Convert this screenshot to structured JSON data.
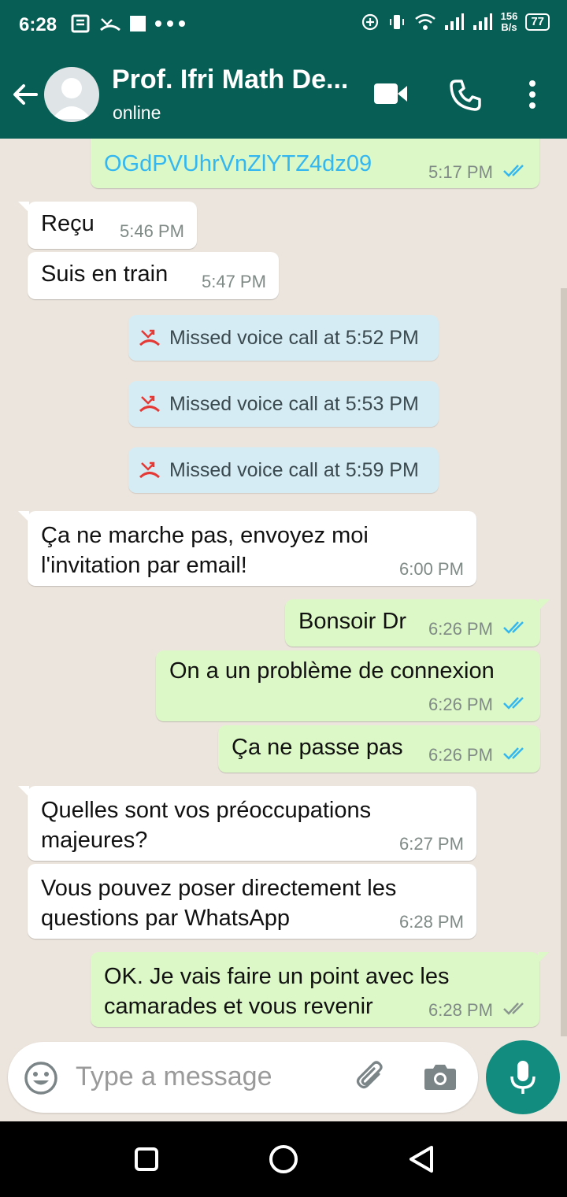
{
  "status_bar": {
    "time": "6:28",
    "net_speed_value": "156",
    "net_speed_unit": "B/s",
    "battery": "77"
  },
  "header": {
    "contact_name": "Prof. Ifri Math De...",
    "status": "online"
  },
  "messages": {
    "m0": {
      "text": "OGdPVUhrVnZlYTZ4dz09",
      "time": "5:17 PM",
      "direction": "outgoing",
      "read": true
    },
    "m1": {
      "text": "Reçu",
      "time": "5:46 PM",
      "direction": "incoming"
    },
    "m2": {
      "text": "Suis en train",
      "time": "5:47 PM",
      "direction": "incoming"
    },
    "s1": {
      "text": "Missed voice call at 5:52 PM"
    },
    "s2": {
      "text": "Missed voice call at 5:53 PM"
    },
    "s3": {
      "text": "Missed voice call at 5:59 PM"
    },
    "m3": {
      "text": "Ça ne marche pas, envoyez moi\nl'invitation par email!",
      "time": "6:00 PM",
      "direction": "incoming"
    },
    "m4": {
      "text": "Bonsoir Dr",
      "time": "6:26 PM",
      "direction": "outgoing",
      "read": true
    },
    "m5": {
      "text": "On a un problème de connexion",
      "time": "6:26 PM",
      "direction": "outgoing",
      "read": true
    },
    "m6": {
      "text": "Ça ne passe pas",
      "time": "6:26 PM",
      "direction": "outgoing",
      "read": true
    },
    "m7": {
      "text": "Quelles sont vos préoccupations\nmajeures?",
      "time": "6:27 PM",
      "direction": "incoming"
    },
    "m8": {
      "text": "Vous pouvez poser directement les\nquestions par WhatsApp",
      "time": "6:28 PM",
      "direction": "incoming"
    },
    "m9": {
      "text": "OK. Je vais faire un point avec les\ncamarades et vous revenir",
      "time": "6:28 PM",
      "direction": "outgoing",
      "read": false
    }
  },
  "input": {
    "placeholder": "Type a message",
    "value": ""
  },
  "icons": {
    "back": "arrow-back-icon",
    "video": "video-call-icon",
    "call": "phone-icon",
    "menu": "more-vert-icon",
    "missed_call": "missed-call-icon",
    "emoji": "emoji-icon",
    "attach": "paperclip-icon",
    "camera": "camera-icon",
    "mic": "mic-icon"
  },
  "colors": {
    "header": "#075e54",
    "chat_bg": "#ece5dd",
    "outgoing": "#dcf8c6",
    "incoming": "#ffffff",
    "read_ticks": "#34b7f1",
    "mic_button": "#128c7e"
  }
}
